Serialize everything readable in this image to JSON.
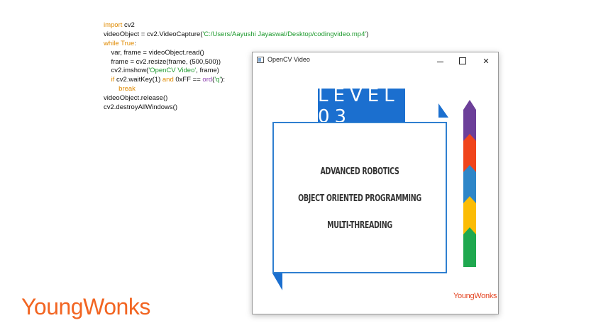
{
  "code": {
    "lines": [
      [
        {
          "t": "import",
          "c": "kw"
        },
        {
          "t": " cv2",
          "c": ""
        }
      ],
      [
        {
          "t": "videoObject = cv2.VideoCapture(",
          "c": ""
        },
        {
          "t": "'C:/Users/Aayushi Jayaswal/Desktop/codingvideo.mp4'",
          "c": "str"
        },
        {
          "t": ")",
          "c": ""
        }
      ],
      [
        {
          "t": "while",
          "c": "kw"
        },
        {
          "t": " ",
          "c": ""
        },
        {
          "t": "True",
          "c": "kw"
        },
        {
          "t": ":",
          "c": ""
        }
      ],
      [
        {
          "t": "    var, frame = videoObject.read()",
          "c": ""
        }
      ],
      [
        {
          "t": "    frame = cv2.resize(frame, (500,500))",
          "c": ""
        }
      ],
      [
        {
          "t": "    cv2.imshow(",
          "c": ""
        },
        {
          "t": "'OpenCV Video'",
          "c": "str"
        },
        {
          "t": ", frame)",
          "c": ""
        }
      ],
      [
        {
          "t": "    ",
          "c": ""
        },
        {
          "t": "if",
          "c": "kw"
        },
        {
          "t": " cv2.waitKey(1) ",
          "c": ""
        },
        {
          "t": "and",
          "c": "kw"
        },
        {
          "t": " 0xFF == ",
          "c": ""
        },
        {
          "t": "ord",
          "c": "fn"
        },
        {
          "t": "(",
          "c": ""
        },
        {
          "t": "'q'",
          "c": "str"
        },
        {
          "t": "):",
          "c": ""
        }
      ],
      [
        {
          "t": "        ",
          "c": ""
        },
        {
          "t": "break",
          "c": "kw"
        }
      ],
      [
        {
          "t": "videoObject.release()",
          "c": ""
        }
      ],
      [
        {
          "t": "cv2.destroyAllWindows()",
          "c": ""
        }
      ]
    ]
  },
  "brand": "YoungWonks",
  "window": {
    "title": "OpenCV Video",
    "minimize": "",
    "maximize": "",
    "close": "✕"
  },
  "frame": {
    "level": "LEVEL 03",
    "topics": [
      "ADVANCED ROBOTICS",
      "OBJECT ORIENTED PROGRAMMING",
      "MULTI-THREADING"
    ],
    "brand": "YoungWonks",
    "arrow_colors": [
      "#6c3f99",
      "#f0441b",
      "#2e86c8",
      "#fbbc05",
      "#1fa84f"
    ]
  }
}
